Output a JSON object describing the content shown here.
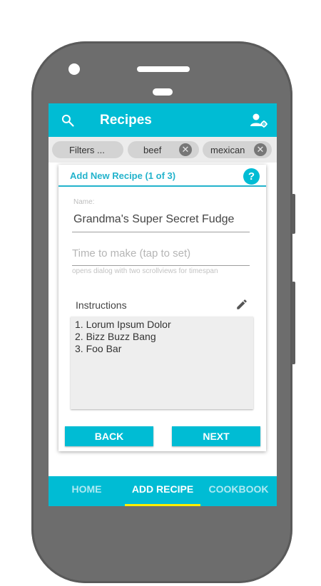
{
  "appbar": {
    "title": "Recipes",
    "search_icon": "search-icon",
    "account_icon": "account-settings-icon"
  },
  "filters": {
    "chips": [
      {
        "label": "Filters ..."
      },
      {
        "label": "beef",
        "removable": true
      },
      {
        "label": "mexican",
        "removable": true
      }
    ],
    "remove_glyph": "✕"
  },
  "card": {
    "title": "Add New Recipe (1 of 3)",
    "help_label": "?",
    "name_field": {
      "label": "Name:",
      "value": "Grandma's Super Secret Fudge"
    },
    "time_field": {
      "placeholder": "Time to make (tap to set)",
      "hint": "opens dialog with two scrollviews for timespan"
    },
    "instructions": {
      "label": "Instructions",
      "lines": [
        "1. Lorum Ipsum Dolor",
        "2. Bizz Buzz Bang",
        "3. Foo Bar"
      ]
    },
    "back_label": "BACK",
    "next_label": "NEXT"
  },
  "nav": {
    "items": [
      {
        "label": "HOME",
        "active": false
      },
      {
        "label": "ADD RECIPE",
        "active": true
      },
      {
        "label": "COOKBOOK",
        "active": false
      }
    ]
  },
  "colors": {
    "accent": "#00bcd4",
    "active_indicator": "#ffee00",
    "inactive_nav_text": "#aee9f2",
    "device_body": "#6d6d6d"
  }
}
